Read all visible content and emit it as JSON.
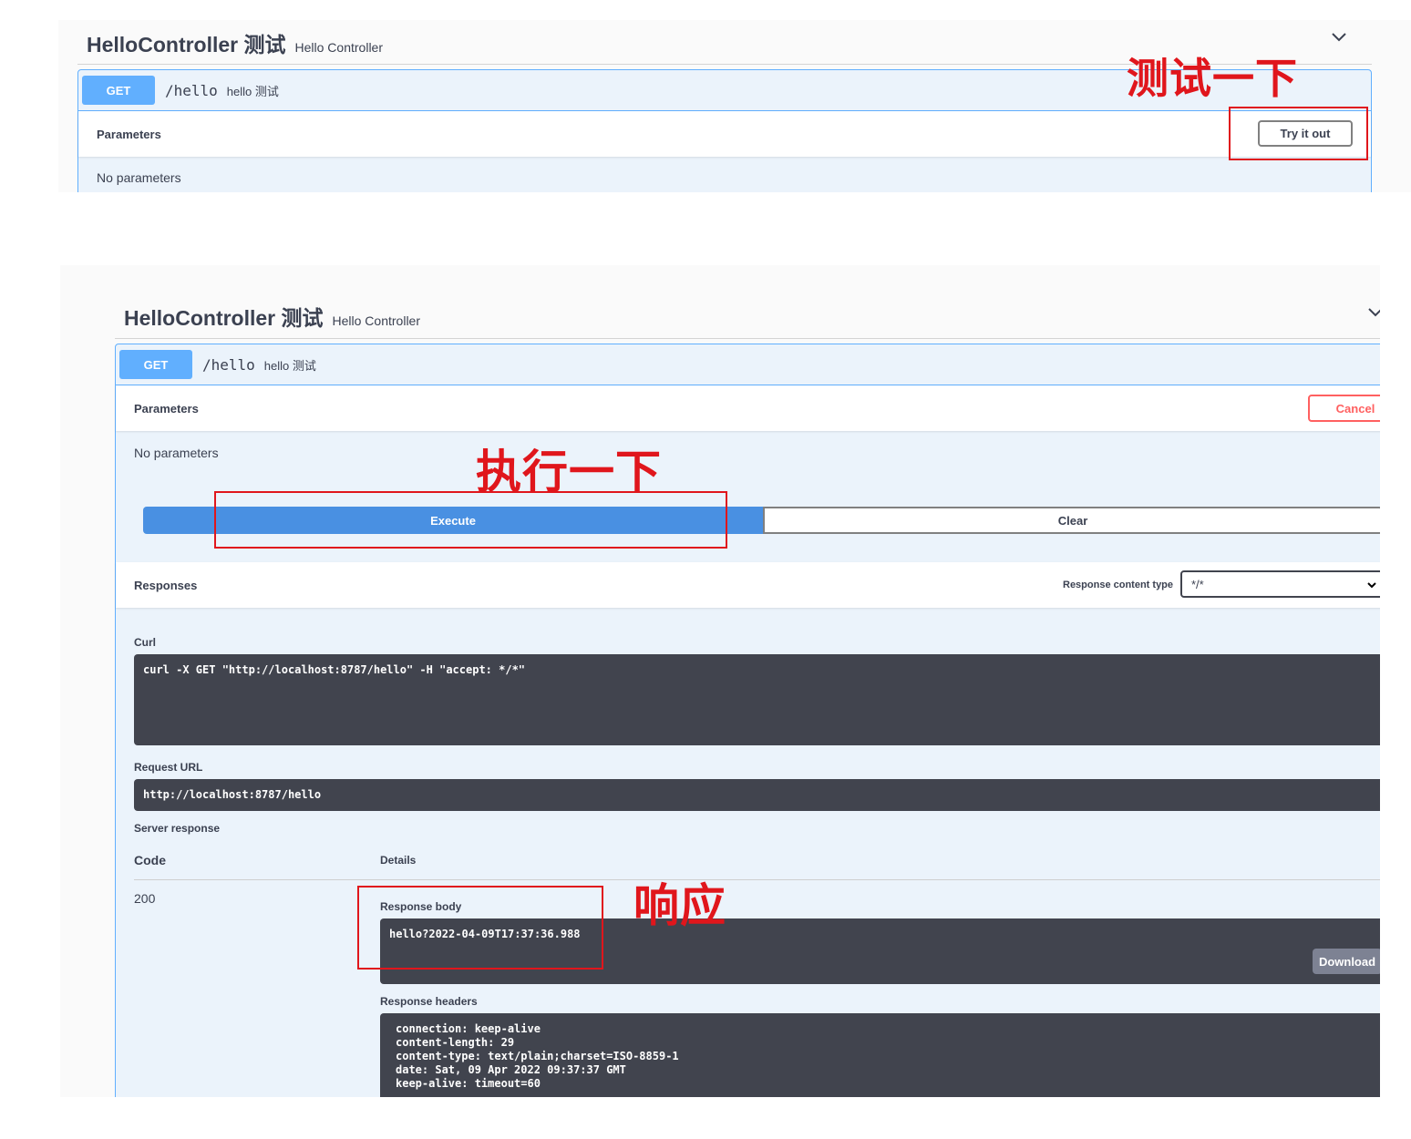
{
  "top_panel": {
    "tag_title": "HelloController 测试",
    "tag_desc": "Hello Controller",
    "method": "GET",
    "path": "/hello",
    "summary": "hello 测试",
    "parameters_label": "Parameters",
    "try_it_out_label": "Try it out",
    "no_parameters": "No parameters",
    "annotation": "测试一下"
  },
  "bottom_panel": {
    "tag_title": "HelloController 测试",
    "tag_desc": "Hello Controller",
    "method": "GET",
    "path": "/hello",
    "summary": "hello 测试",
    "parameters_label": "Parameters",
    "cancel_label": "Cancel",
    "no_parameters": "No parameters",
    "execute_label": "Execute",
    "clear_label": "Clear",
    "annotation_execute": "执行一下",
    "responses_label": "Responses",
    "response_content_type_label": "Response content type",
    "response_content_type_value": "*/*",
    "curl_label": "Curl",
    "curl_command": "curl -X GET \"http://localhost:8787/hello\" -H \"accept: */*\"",
    "request_url_label": "Request URL",
    "request_url": "http://localhost:8787/hello",
    "server_response_label": "Server response",
    "code_header": "Code",
    "details_header": "Details",
    "status_code": "200",
    "response_body_label": "Response body",
    "response_body": "hello?2022-04-09T17:37:36.988",
    "download_label": "Download",
    "annotation_response": "响应",
    "response_headers_label": "Response headers",
    "response_headers": "connection: keep-alive\ncontent-length: 29\ncontent-type: text/plain;charset=ISO-8859-1\ndate: Sat, 09 Apr 2022 09:37:37 GMT\nkeep-alive: timeout=60"
  }
}
